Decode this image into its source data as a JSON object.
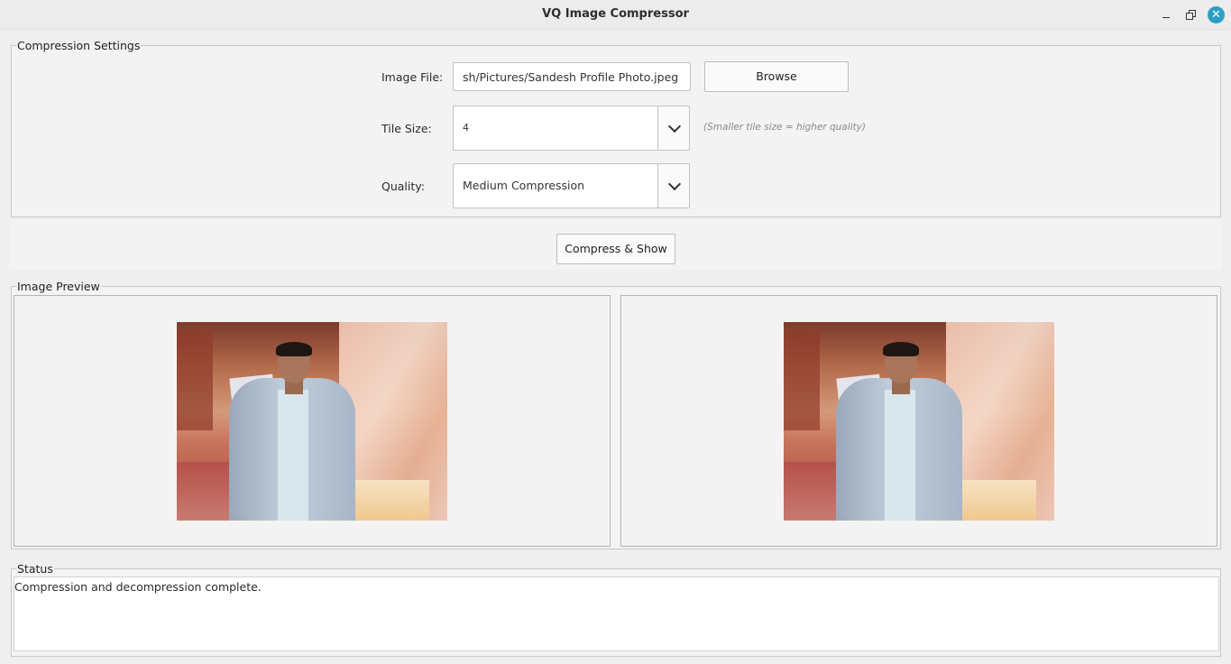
{
  "window": {
    "title": "VQ Image Compressor"
  },
  "settings": {
    "legend": "Compression Settings",
    "image_file_label": "Image File:",
    "image_file_value": "sh/Pictures/Sandesh Profile Photo.jpeg",
    "browse_label": "Browse",
    "tile_size_label": "Tile Size:",
    "tile_size_value": "4",
    "tile_size_hint": "(Smaller tile size = higher quality)",
    "quality_label": "Quality:",
    "quality_value": "Medium Compression"
  },
  "actions": {
    "compress_label": "Compress & Show"
  },
  "preview": {
    "legend": "Image Preview"
  },
  "status": {
    "legend": "Status",
    "message": "Compression and decompression complete."
  },
  "icons": {
    "minimize": "minimize-icon",
    "maximize": "maximize-icon",
    "close": "close-icon",
    "dropdown": "chevron-down-icon"
  },
  "colors": {
    "close_button": "#2e9ec4",
    "window_bg": "#efefef",
    "panel_bg": "#f3f3f3"
  }
}
